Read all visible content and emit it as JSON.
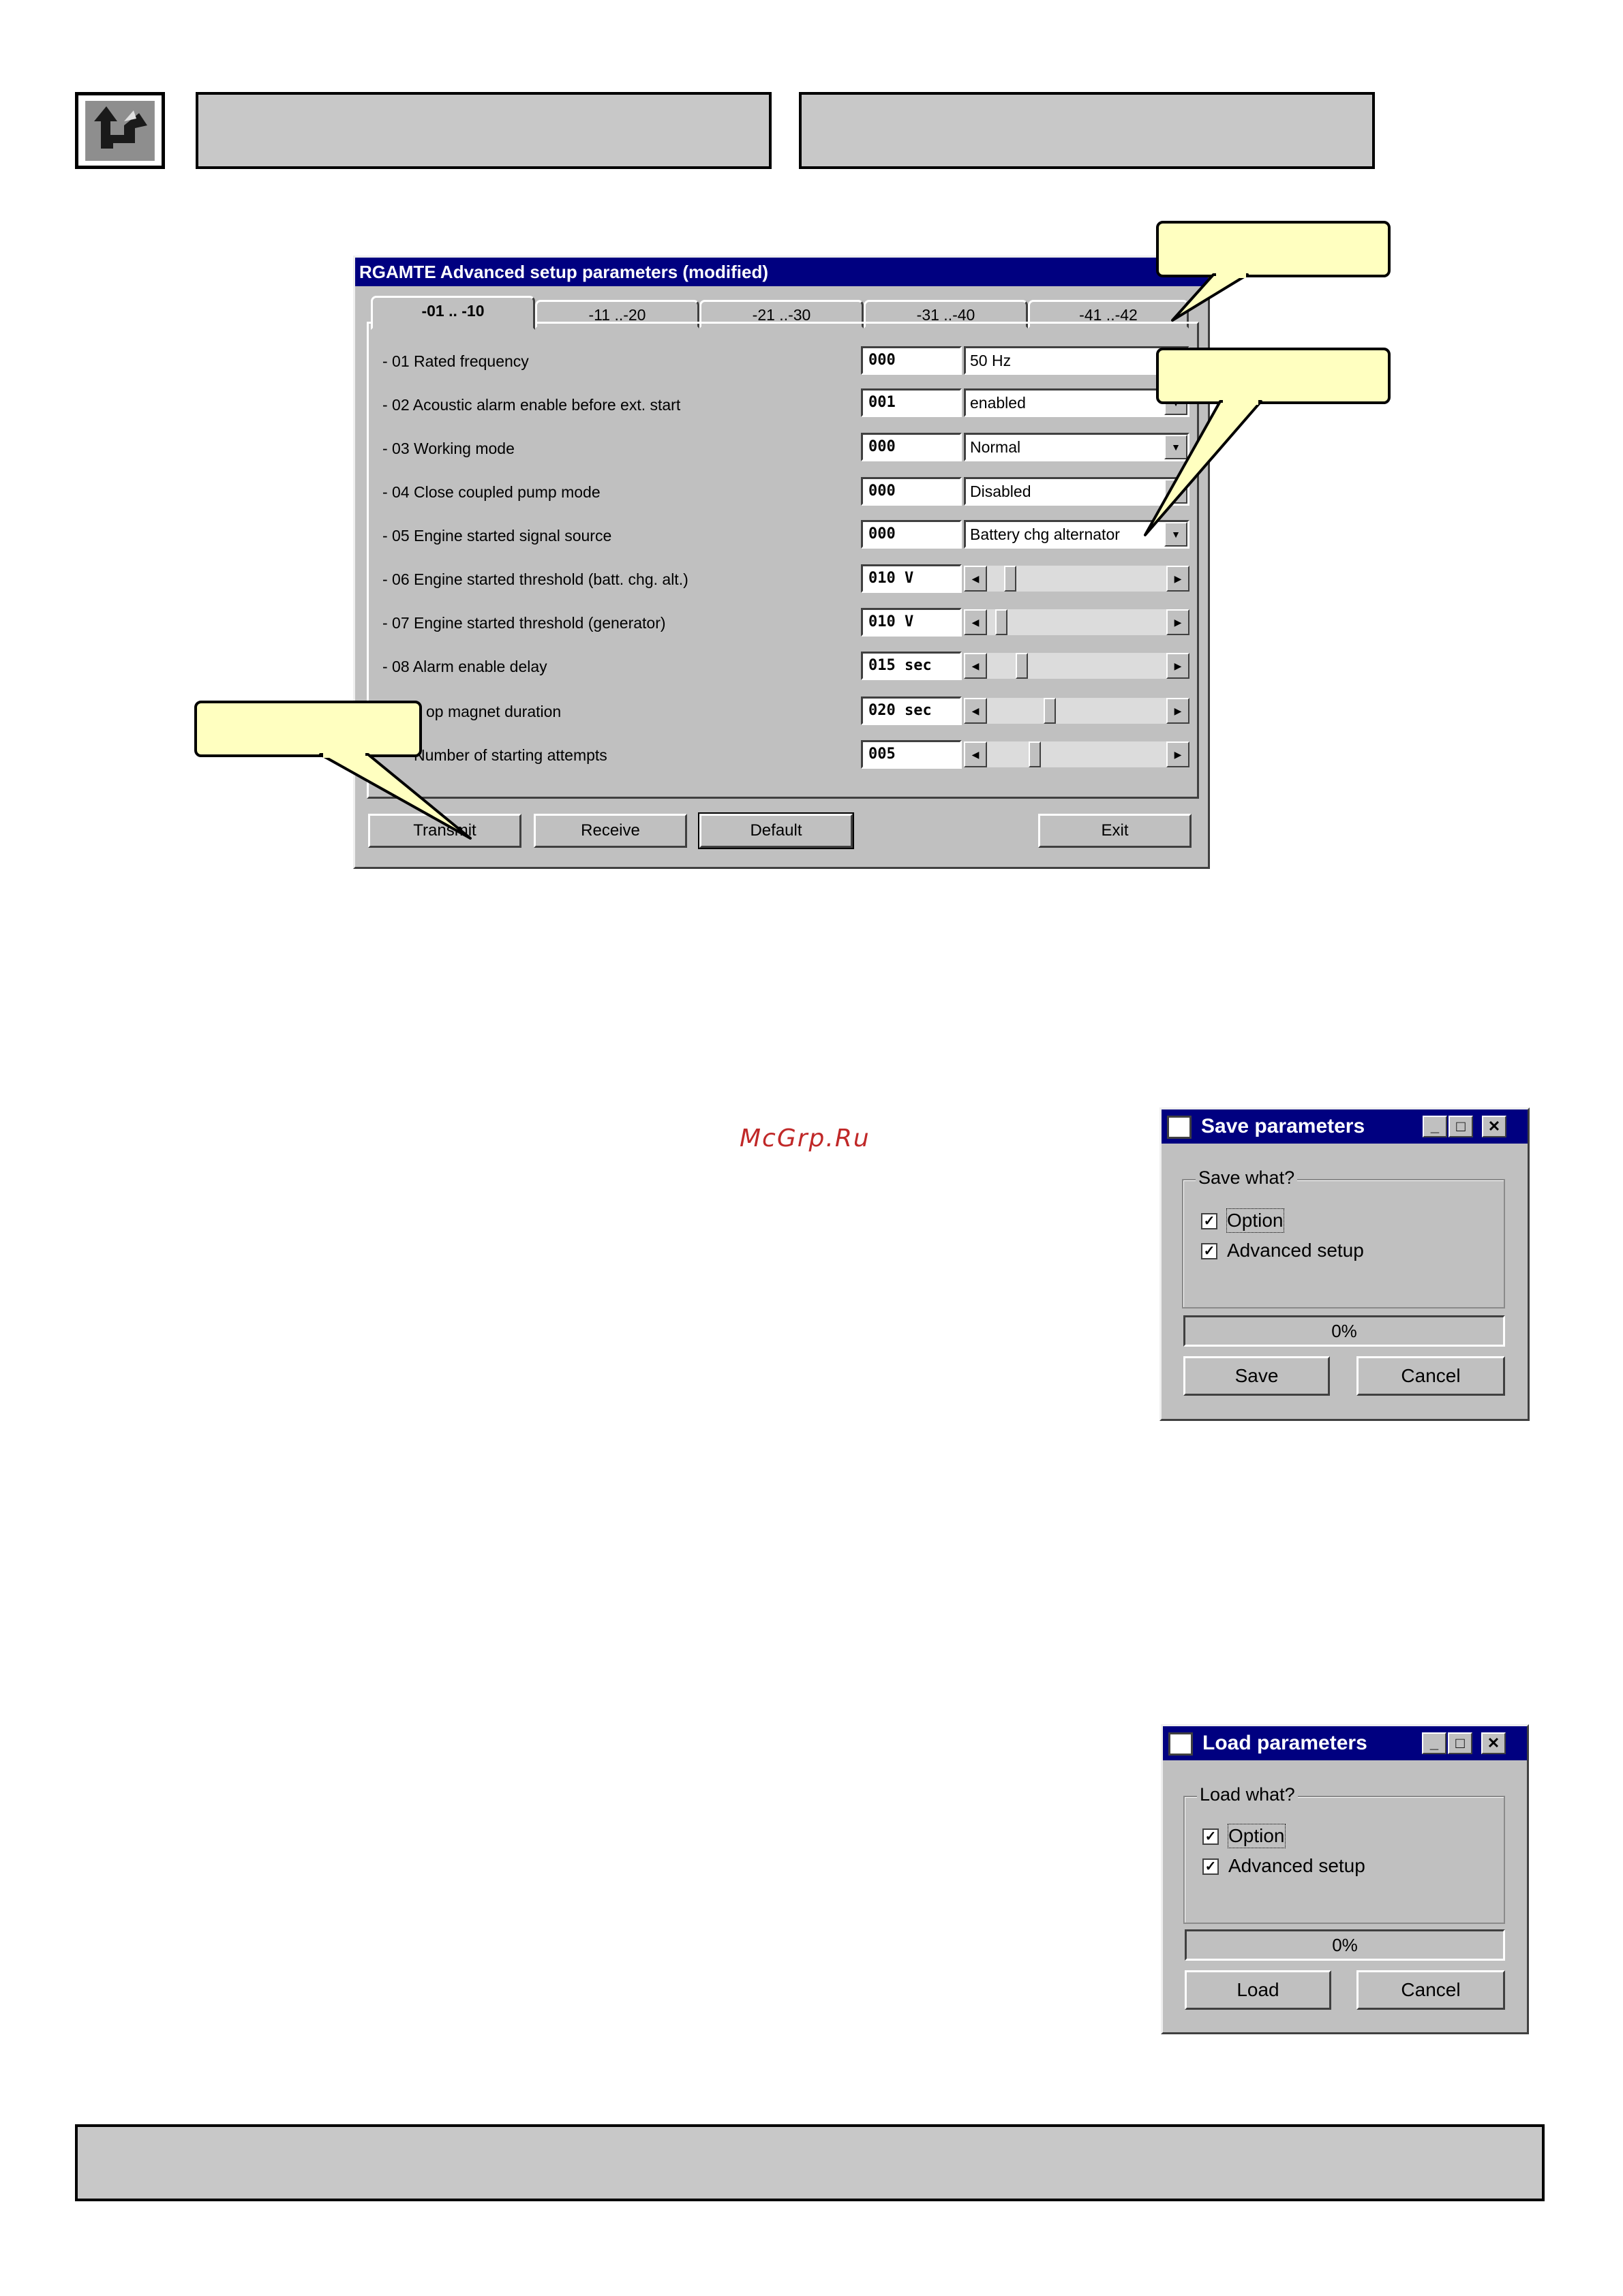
{
  "setup_window": {
    "title": "RGAMTE Advanced setup parameters (modified)",
    "tabs": [
      "-01 .. -10",
      "-11 ..-20",
      "-21 ..-30",
      "-31 ..-40",
      "-41 ..-42"
    ],
    "active_tab": 0,
    "rows": [
      {
        "label": "- 01 Rated frequency",
        "value": "000",
        "control": "combo",
        "option": "50 Hz"
      },
      {
        "label": "- 02 Acoustic alarm enable before ext. start",
        "value": "001",
        "control": "combo",
        "option": "enabled"
      },
      {
        "label": "- 03 Working mode",
        "value": "000",
        "control": "combo",
        "option": "Normal"
      },
      {
        "label": "- 04 Close coupled pump mode",
        "value": "000",
        "control": "combo",
        "option": "Disabled"
      },
      {
        "label": "- 05 Engine started signal source",
        "value": "000",
        "control": "combo",
        "option": "Battery chg alternator"
      },
      {
        "label": "- 06 Engine started threshold (batt. chg. alt.)",
        "value": "010 V",
        "control": "slider",
        "level": 0.1
      },
      {
        "label": "- 07 Engine started threshold (generator)",
        "value": "010 V",
        "control": "slider",
        "level": 0.05
      },
      {
        "label": "- 08 Alarm enable delay",
        "value": "015 sec",
        "control": "slider",
        "level": 0.17
      },
      {
        "label": "op magnet duration",
        "value": "020 sec",
        "control": "slider",
        "level": 0.34
      },
      {
        "label": "Number of starting attempts",
        "value": "005",
        "control": "slider",
        "level": 0.25
      }
    ],
    "buttons": {
      "transmit": "Transmit",
      "receive": "Receive",
      "default": "Default",
      "exit": "Exit"
    }
  },
  "save_dialog": {
    "title": "Save parameters",
    "group_label": "Save what?",
    "options": [
      {
        "label": "Option",
        "checked": true
      },
      {
        "label": "Advanced setup",
        "checked": true
      }
    ],
    "progress": "0%",
    "ok_label": "Save",
    "cancel_label": "Cancel"
  },
  "load_dialog": {
    "title": "Load parameters",
    "group_label": "Load what?",
    "options": [
      {
        "label": "Option",
        "checked": true
      },
      {
        "label": "Advanced setup",
        "checked": true
      }
    ],
    "progress": "0%",
    "ok_label": "Load",
    "cancel_label": "Cancel"
  },
  "watermark": "McGrp.Ru",
  "colors": {
    "titlebar": "#000080",
    "callout": "#ffffc0",
    "header_box": "#c8c8c8",
    "window_face": "#c0c0c0"
  }
}
